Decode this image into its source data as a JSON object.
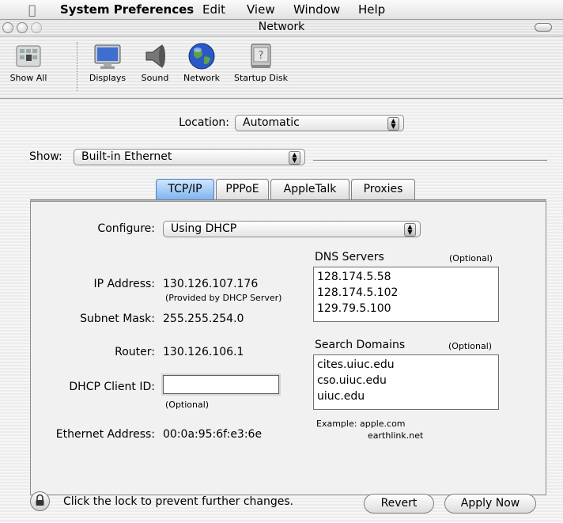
{
  "menubar": {
    "app_name": "System Preferences",
    "items": [
      "Edit",
      "View",
      "Window",
      "Help"
    ]
  },
  "window": {
    "title": "Network"
  },
  "toolbar": {
    "items": [
      {
        "label": "Show All",
        "icon": "show-all-icon"
      },
      {
        "label": "Displays",
        "icon": "displays-icon"
      },
      {
        "label": "Sound",
        "icon": "sound-icon"
      },
      {
        "label": "Network",
        "icon": "network-globe-icon"
      },
      {
        "label": "Startup Disk",
        "icon": "startup-disk-icon"
      }
    ]
  },
  "location": {
    "label": "Location:",
    "value": "Automatic"
  },
  "show": {
    "label": "Show:",
    "value": "Built-in Ethernet"
  },
  "tabs": [
    {
      "label": "TCP/IP",
      "active": true
    },
    {
      "label": "PPPoE",
      "active": false
    },
    {
      "label": "AppleTalk",
      "active": false
    },
    {
      "label": "Proxies",
      "active": false
    }
  ],
  "tcpip": {
    "configure_label": "Configure:",
    "configure_value": "Using DHCP",
    "ip_label": "IP Address:",
    "ip_value": "130.126.107.176",
    "ip_note": "(Provided by DHCP Server)",
    "subnet_label": "Subnet Mask:",
    "subnet_value": "255.255.254.0",
    "router_label": "Router:",
    "router_value": "130.126.106.1",
    "dhcp_client_label": "DHCP Client ID:",
    "dhcp_client_value": "",
    "dhcp_client_note": "(Optional)",
    "ethernet_label": "Ethernet Address:",
    "ethernet_value": "00:0a:95:6f:e3:6e",
    "dns_title": "DNS Servers",
    "dns_optional": "(Optional)",
    "dns_servers": [
      "128.174.5.58",
      "128.174.5.102",
      "129.79.5.100"
    ],
    "search_title": "Search Domains",
    "search_optional": "(Optional)",
    "search_domains": [
      "cites.uiuc.edu",
      "cso.uiuc.edu",
      "uiuc.edu"
    ],
    "example_label": "Example:",
    "example_values": [
      "apple.com",
      "earthlink.net"
    ]
  },
  "footer": {
    "lock_text": "Click the lock to prevent further changes.",
    "revert_label": "Revert",
    "apply_label": "Apply Now"
  },
  "colors": {
    "active_tab": "#7fb5ef",
    "globe": "#2a58c4"
  }
}
